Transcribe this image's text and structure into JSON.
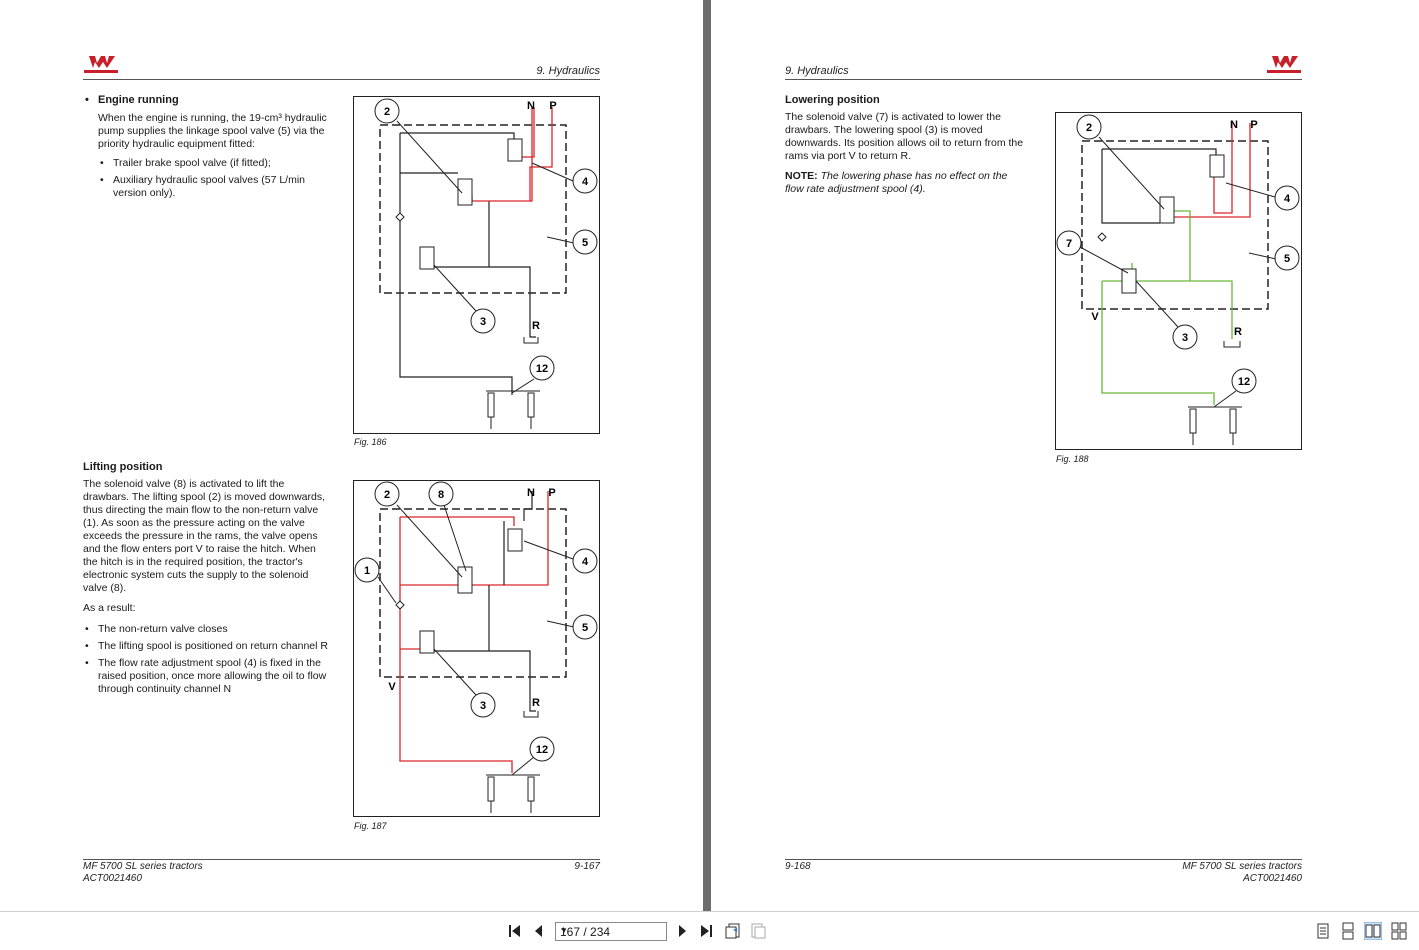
{
  "left_page": {
    "header": "9. Hydraulics",
    "section1": {
      "heading": "Engine running",
      "para": "When the engine is running, the 19-cm³ hydraulic pump supplies the linkage spool valve (5) via the priority hydraulic equipment fitted:",
      "items": [
        "Trailer brake spool valve (if fitted);",
        "Auxiliary hydraulic spool valves (57 L/min version only)."
      ]
    },
    "section2": {
      "heading": "Lifting position",
      "para": "The solenoid valve (8) is activated to lift the drawbars. The lifting spool (2) is moved downwards, thus directing the main flow to the non-return valve (1). As soon as the pressure acting on the valve exceeds the pressure in the rams, the valve opens and the flow enters port V to raise the hitch. When the hitch is in the required position, the tractor's electronic system cuts the supply to the solenoid valve (8).",
      "result": "As a result:",
      "items": [
        "The non-return valve closes",
        "The lifting spool is positioned on return channel R",
        "The flow rate adjustment spool (4) is fixed in the raised position, once more allowing the oil to flow through continuity channel N"
      ]
    },
    "fig186": {
      "caption": "Fig. 186",
      "callouts": [
        "2",
        "4",
        "5",
        "3",
        "12"
      ],
      "ports": [
        "N",
        "P",
        "R"
      ]
    },
    "fig187": {
      "caption": "Fig. 187",
      "callouts": [
        "2",
        "8",
        "4",
        "1",
        "5",
        "3",
        "12"
      ],
      "ports": [
        "N",
        "P",
        "V",
        "R"
      ]
    },
    "footer_title": "MF 5700 SL series tractors",
    "footer_code": "ACT0021460",
    "page_number": "9-167"
  },
  "right_page": {
    "header": "9. Hydraulics",
    "section": {
      "heading": "Lowering position",
      "para": "The solenoid valve (7) is activated to lower the drawbars. The lowering spool (3) is moved downwards. Its position allows oil to return from the rams via port V to return R.",
      "note_label": "NOTE:",
      "note_text": "The lowering phase has no effect on the flow rate adjustment spool (4)."
    },
    "fig188": {
      "caption": "Fig. 188",
      "callouts": [
        "2",
        "4",
        "7",
        "5",
        "3",
        "12"
      ],
      "ports": [
        "N",
        "P",
        "V",
        "R"
      ]
    },
    "page_number": "9-168",
    "footer_title": "MF 5700 SL series tractors",
    "footer_code": "ACT0021460"
  },
  "toolbar": {
    "page_indicator": "167 / 234",
    "first_icon": "first-page-icon",
    "prev_icon": "previous-page-icon",
    "next_icon": "next-page-icon",
    "last_icon": "last-page-icon"
  },
  "colors": {
    "pressure": "#d9262b",
    "return": "#6ab83a",
    "line": "#222222",
    "background": "#6d6d6d"
  }
}
